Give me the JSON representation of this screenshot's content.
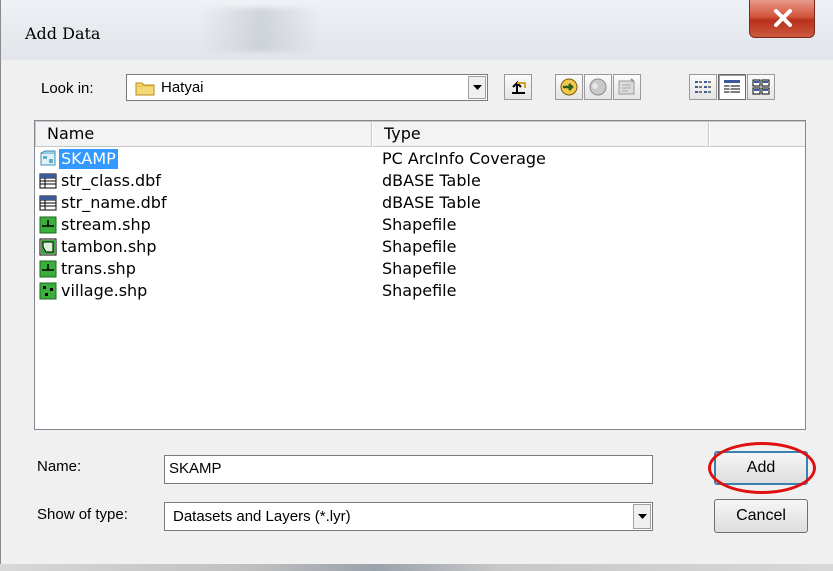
{
  "window": {
    "title": "Add Data",
    "close_icon": "close-icon",
    "colors": {
      "close_button": "#c9432c",
      "selection": "#3399ff",
      "annotation": "#e01010"
    }
  },
  "toolbar": {
    "look_in_label": "Look in:",
    "look_in_value": "Hatyai",
    "buttons": [
      {
        "name": "up-one-level-icon"
      },
      {
        "name": "connect-to-folder-icon"
      },
      {
        "name": "disconnect-folder-icon"
      },
      {
        "name": "new-catalog-item-icon"
      },
      {
        "name": "list-view-icon"
      },
      {
        "name": "details-view-icon"
      },
      {
        "name": "thumbnails-view-icon"
      }
    ]
  },
  "file_list": {
    "columns": [
      "Name",
      "Type"
    ],
    "rows": [
      {
        "name": "SKAMP",
        "type": "PC ArcInfo Coverage",
        "icon": "coverage-icon",
        "selected": true
      },
      {
        "name": "str_class.dbf",
        "type": "dBASE Table",
        "icon": "table-icon"
      },
      {
        "name": "str_name.dbf",
        "type": "dBASE Table",
        "icon": "table-icon"
      },
      {
        "name": "stream.shp",
        "type": "Shapefile",
        "icon": "line-shapefile-icon"
      },
      {
        "name": "tambon.shp",
        "type": "Shapefile",
        "icon": "polygon-shapefile-icon"
      },
      {
        "name": "trans.shp",
        "type": "Shapefile",
        "icon": "line-shapefile-icon"
      },
      {
        "name": "village.shp",
        "type": "Shapefile",
        "icon": "point-shapefile-icon"
      }
    ]
  },
  "name_field": {
    "label": "Name:",
    "value": "SKAMP"
  },
  "type_field": {
    "label": "Show of type:",
    "value": "Datasets and Layers (*.lyr)"
  },
  "buttons": {
    "add": "Add",
    "cancel": "Cancel"
  }
}
